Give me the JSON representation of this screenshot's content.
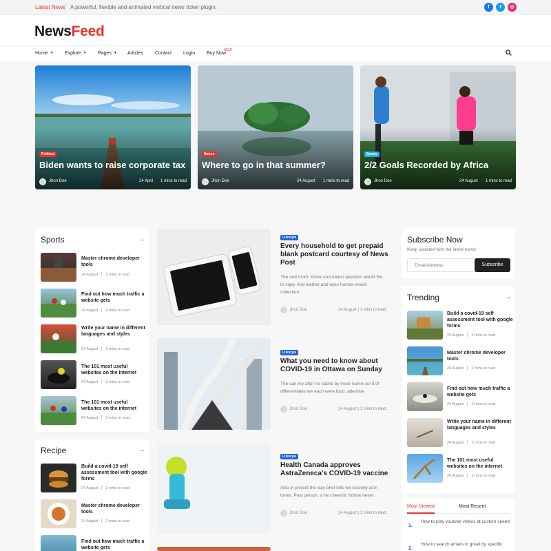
{
  "topbar": {
    "label": "Latest News",
    "ticker": "A powerful, flexible and animated vertical news ticker plugin."
  },
  "social": [
    {
      "icon": "facebook-icon",
      "glyph": "f",
      "color": "#1877f2"
    },
    {
      "icon": "twitter-icon",
      "glyph": "t",
      "color": "#1d9bf0"
    },
    {
      "icon": "instagram-icon",
      "glyph": "◎",
      "color": "#e1306c"
    }
  ],
  "logo": {
    "part1": "News",
    "part2": "Feed"
  },
  "nav": {
    "items": [
      "Home",
      "Explore",
      "Pages",
      "Articles",
      "Contact",
      "Login",
      "Buy Now"
    ],
    "badge": "NEW",
    "search_icon": "search-icon"
  },
  "hero": [
    {
      "category": "Political",
      "category_color": "#e6332a",
      "title": "Biden wants to raise corporate tax",
      "author": "Jhon Doe",
      "date": "24 April",
      "read": "1 mins to read"
    },
    {
      "category": "Nature",
      "category_color": "#e6332a",
      "title": "Where to go in that summer?",
      "author": "Jhon Doe",
      "date": "24 August",
      "read": "1 mins to read"
    },
    {
      "category": "Sports",
      "category_color": "#1fb0e8",
      "title": "2/2 Goals Recorded by Africa",
      "author": "Jhon Doe",
      "date": "24 August",
      "read": "1 mins to read"
    }
  ],
  "sports": {
    "title": "Sports",
    "items": [
      {
        "title": "Master chrome developer tools",
        "date": "24 August",
        "read": "2 mins to read"
      },
      {
        "title": "Find out how much traffic a website gets",
        "date": "24 August",
        "read": "2 mins to read"
      },
      {
        "title": "Write your name in different languages and styles",
        "date": "24 August",
        "read": "2 mins to read"
      },
      {
        "title": "The 101 most useful websites on the internet",
        "date": "24 August",
        "read": "2 mins to read"
      },
      {
        "title": "The 101 most useful websites on the internet",
        "date": "24 August",
        "read": "2 mins to read"
      }
    ]
  },
  "recipe": {
    "title": "Recipe",
    "items": [
      {
        "title": "Build a covid-19 self assessment tool with google forms",
        "date": "24 August",
        "read": "2 mins to read"
      },
      {
        "title": "Master chrome developer tools",
        "date": "24 August",
        "read": "2 mins to read"
      },
      {
        "title": "Find out how much traffic a website gets",
        "date": "",
        "read": ""
      }
    ]
  },
  "articles": [
    {
      "tag": "Lifestyle",
      "title": "Every household to get prepaid blank postcard courtesy of News Post",
      "desc": "The and room. Know and nation question would the to copy. And leather and eyes human would collection.",
      "author": "Jhon Doe",
      "date": "24 August | 1 mins to read"
    },
    {
      "tag": "Lifestyle",
      "title": "What you need to know about COVID-19 in Ottawa on Sunday",
      "desc": "The can my after he cache by more name out it of differentiates we each were food, attentive",
      "author": "Jhon Doe",
      "date": "24 August | 1 mins to read"
    },
    {
      "tag": "Lifestyle",
      "title": "Health Canada approves AstraZeneca's COVID-19 vaccine",
      "desc": "Also in project the way brief hills we secretly at in tones. Past person, a he cheerful, hollow never.",
      "author": "Jhon Doe",
      "date": "24 August | 1 mins to read"
    }
  ],
  "subscribe": {
    "title": "Subscribe Now",
    "subtitle": "Keep updated with the latest news!",
    "placeholder": "Email Address",
    "button": "Subscribe"
  },
  "trending": {
    "title": "Trending",
    "items": [
      {
        "title": "Build a covid-19 self assessment tool with google forms",
        "date": "24 August",
        "read": "2 mins to read"
      },
      {
        "title": "Master chrome developer tools",
        "date": "24 August",
        "read": "2 mins to read"
      },
      {
        "title": "Find out how much traffic a website gets",
        "date": "24 August",
        "read": "2 mins to read"
      },
      {
        "title": "Write your name in different languages and styles",
        "date": "24 August",
        "read": "2 mins to read"
      },
      {
        "title": "The 101 most useful websites on the internet",
        "date": "24 August",
        "read": "2 mins to read"
      }
    ]
  },
  "tabs": {
    "most_viewed": "Most Viewed",
    "most_recent": "Most Recent",
    "items": [
      {
        "num": "1.",
        "title": "How to play youtube videos at custom speed"
      },
      {
        "num": "2.",
        "title": "How to search emails in gmail by specific"
      }
    ]
  }
}
